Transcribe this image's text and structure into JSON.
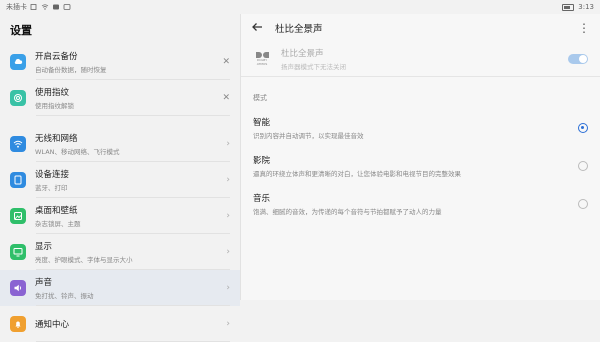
{
  "status": {
    "carrier": "未插卡",
    "time": "3:13"
  },
  "left": {
    "title": "设置",
    "items": [
      {
        "name": "cloud-backup",
        "label": "开启云备份",
        "sub": "自动备份数据，随时恢复",
        "icon": "cloud-icon",
        "color": "#3aa0e8",
        "action": "close"
      },
      {
        "name": "fingerprint",
        "label": "使用指纹",
        "sub": "使用指纹解锁",
        "icon": "fingerprint-icon",
        "color": "#39c2a6",
        "action": "close"
      },
      {
        "name": "wireless",
        "label": "无线和网络",
        "sub": "WLAN、移动网络、飞行模式",
        "icon": "wifi-icon",
        "color": "#2f8be0",
        "action": "chevron"
      },
      {
        "name": "device-connect",
        "label": "设备连接",
        "sub": "蓝牙、打印",
        "icon": "device-icon",
        "color": "#2f8be0",
        "action": "chevron"
      },
      {
        "name": "desktop-wallpaper",
        "label": "桌面和壁纸",
        "sub": "杂志锁屏、主题",
        "icon": "wallpaper-icon",
        "color": "#2fbf6a",
        "action": "chevron"
      },
      {
        "name": "display",
        "label": "显示",
        "sub": "亮度、护眼模式、字体与显示大小",
        "icon": "display-icon",
        "color": "#2fbf6a",
        "action": "chevron"
      },
      {
        "name": "sound",
        "label": "声音",
        "sub": "免打扰、铃声、振动",
        "icon": "speaker-icon",
        "color": "#8a63d2",
        "action": "chevron",
        "selected": true
      },
      {
        "name": "notification",
        "label": "通知中心",
        "sub": "",
        "icon": "bell-icon",
        "color": "#f0a030",
        "action": "chevron"
      }
    ]
  },
  "right": {
    "title": "杜比全景声",
    "dolby": {
      "logo_top": "DOLBY",
      "logo_bottom": "ATMOS",
      "label": "杜比全景声",
      "sub": "扬声器模式下无法关闭"
    },
    "mode_label": "模式",
    "modes": [
      {
        "label": "智能",
        "sub": "识别内容并自动调节，以实现最佳音效",
        "selected": true
      },
      {
        "label": "影院",
        "sub": "逼真的环绕立体声和更清晰的对白，让您体验电影和电视节目的完整效果",
        "selected": false
      },
      {
        "label": "音乐",
        "sub": "饱满、细腻的音效，为传递的每个音符与节拍都赋予了动人的力量",
        "selected": false
      }
    ]
  },
  "colors": {
    "accent": "#2c6fd6",
    "toggle": "#a9c9ec"
  }
}
